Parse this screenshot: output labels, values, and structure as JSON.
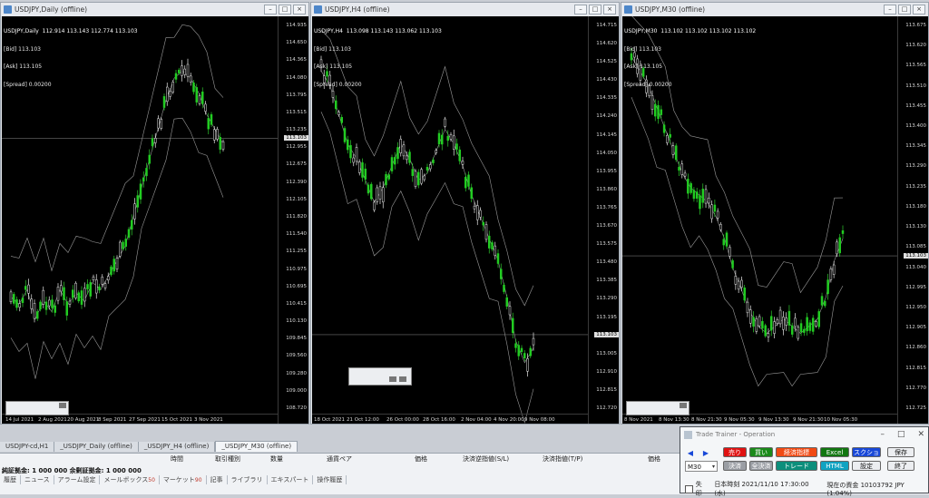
{
  "windows": [
    {
      "title": "USDJPY,Daily (offline)",
      "info": [
        "USDJPY,Daily  112.914 113.143 112.774 113.103",
        "[Bid] 113.103",
        "[Ask] 113.105",
        "[Spread] 0.00200"
      ],
      "price_ticks": [
        "114.935",
        "114.650",
        "114.365",
        "114.080",
        "113.795",
        "113.515",
        "113.235",
        "112.955",
        "112.675",
        "112.390",
        "112.105",
        "111.820",
        "111.540",
        "111.255",
        "110.975",
        "110.695",
        "110.415",
        "110.130",
        "109.845",
        "109.560",
        "109.280",
        "109.000",
        "108.720"
      ],
      "price_marker": "113.103",
      "date_ticks": [
        "14 Jul 2021",
        "2 Aug 2021",
        "20 Aug 2021",
        "8 Sep 2021",
        "27 Sep 2021",
        "15 Oct 2021",
        "3 Nov 2021"
      ]
    },
    {
      "title": "USDJPY,H4 (offline)",
      "info": [
        "USDJPY,H4  113.098 113.143 113.062 113.103",
        "[Bid] 113.103",
        "[Ask] 113.105",
        "[Spread] 0.00200"
      ],
      "price_ticks": [
        "114.715",
        "114.620",
        "114.525",
        "114.430",
        "114.335",
        "114.240",
        "114.145",
        "114.050",
        "113.955",
        "113.860",
        "113.765",
        "113.670",
        "113.575",
        "113.480",
        "113.385",
        "113.290",
        "113.195",
        "113.100",
        "113.005",
        "112.910",
        "112.815",
        "112.720"
      ],
      "price_marker": "113.103",
      "date_ticks": [
        "18 Oct 2021",
        "21 Oct 12:00",
        "26 Oct 00:00",
        "28 Oct 16:00",
        "2 Nov 04:00",
        "4 Nov 20:00",
        "9 Nov 08:00"
      ]
    },
    {
      "title": "USDJPY,M30 (offline)",
      "info": [
        "USDJPY,M30  113.102 113.102 113.102 113.102",
        "[Bid] 113.103",
        "[Ask] 113.105",
        "[Spread] 0.00200"
      ],
      "price_ticks": [
        "113.675",
        "113.620",
        "113.565",
        "113.510",
        "113.455",
        "113.400",
        "113.345",
        "113.290",
        "113.235",
        "113.180",
        "113.130",
        "113.085",
        "113.040",
        "112.995",
        "112.950",
        "112.905",
        "112.860",
        "112.815",
        "112.770",
        "112.725"
      ],
      "price_marker": "113.103",
      "date_ticks": [
        "8 Nov 2021",
        "8 Nov 13:30",
        "8 Nov 21:30",
        "9 Nov 05:30",
        "9 Nov 13:30",
        "9 Nov 21:30",
        "10 Nov 05:30"
      ]
    }
  ],
  "tabs": [
    "USDJPY-cd,H1",
    "_USDJPY_Daily (offline)",
    "_USDJPY_H4 (offline)",
    "_USDJPY_M30 (offline)"
  ],
  "active_tab": 3,
  "terminal": {
    "columns": [
      "時間",
      "取引種別",
      "数量",
      "通貨ペア",
      "価格",
      "決済逆指値(S/L)",
      "決済指値(T/P)",
      "価格"
    ],
    "balance": "純証拠金: 1 000 000  余剰証拠金: 1 000 000",
    "tabs": [
      {
        "label": "履歴",
        "badge": ""
      },
      {
        "label": "ニュース",
        "badge": ""
      },
      {
        "label": "アラーム設定",
        "badge": ""
      },
      {
        "label": "メールボックス",
        "badge": "50"
      },
      {
        "label": "マーケット",
        "badge": "90"
      },
      {
        "label": "記事",
        "badge": ""
      },
      {
        "label": "ライブラリ",
        "badge": ""
      },
      {
        "label": "エキスパート",
        "badge": ""
      },
      {
        "label": "操作履歴",
        "badge": ""
      }
    ]
  },
  "trade_trainer": {
    "title": "Trade Trainer - Operation",
    "timeframe": "M30",
    "buttons": {
      "sell": "売り",
      "buy": "買い",
      "indicators": "経済指標",
      "excel": "Excel",
      "screenshot": "スクショ",
      "save": "保存",
      "close": "決済",
      "close_all": "全決済",
      "trade": "トレード",
      "html": "HTML",
      "settings": "設定",
      "exit": "終了"
    },
    "status": {
      "checkbox_label": "失印",
      "time": "日本時刻 2021/11/10 17:30:00 (水)",
      "balance": "現在の資金 10103792 JPY (1.04%)"
    }
  }
}
